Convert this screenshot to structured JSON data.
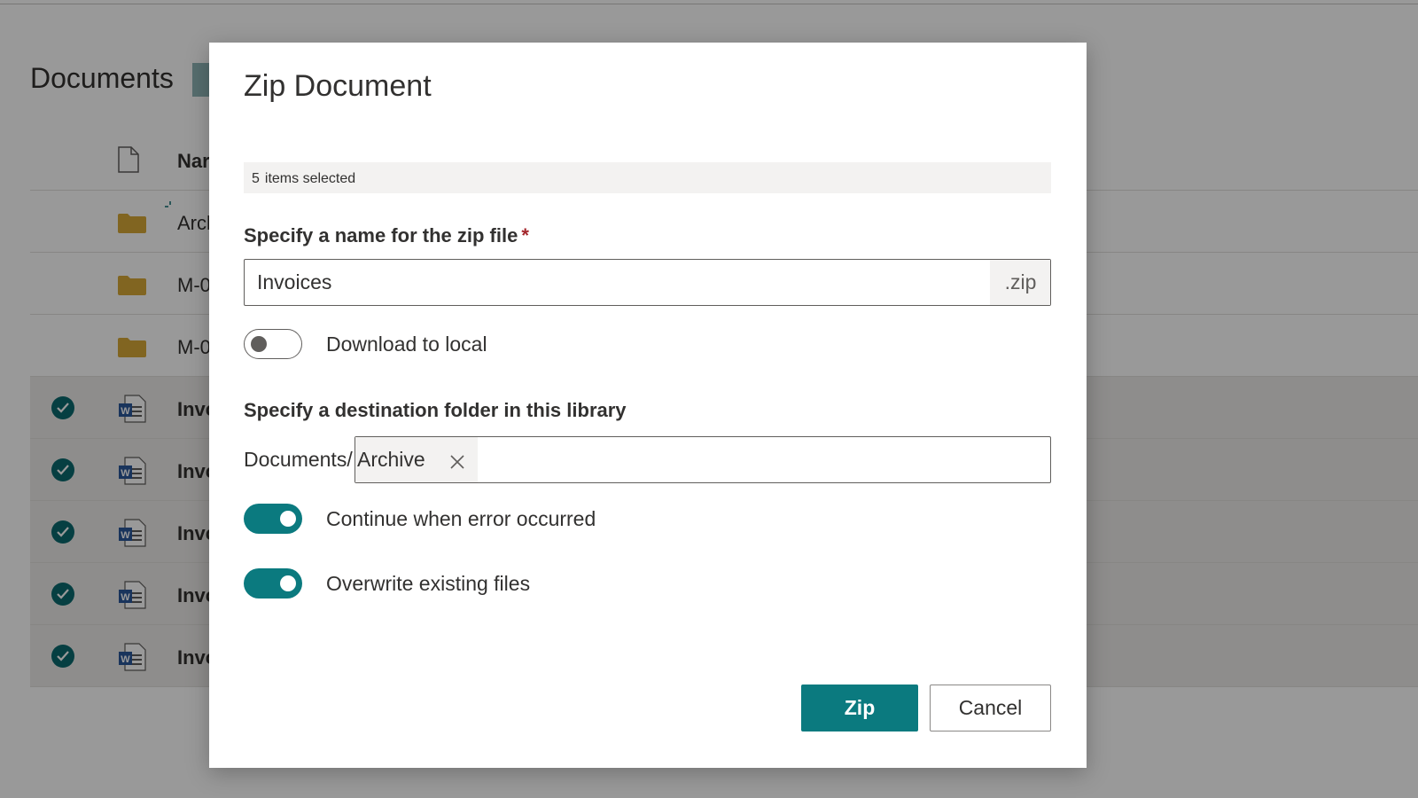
{
  "background": {
    "library_title": "Documents",
    "header": {
      "name_col": "Nar"
    },
    "rows": [
      {
        "name": "Arcl",
        "type": "folder",
        "selected": false
      },
      {
        "name": "M-0",
        "type": "folder",
        "selected": false
      },
      {
        "name": "M-0",
        "type": "folder",
        "selected": false
      },
      {
        "name": "Invc",
        "type": "word",
        "selected": true
      },
      {
        "name": "Invc",
        "type": "word",
        "selected": true
      },
      {
        "name": "Invc",
        "type": "word",
        "selected": true
      },
      {
        "name": "Invc",
        "type": "word",
        "selected": true
      },
      {
        "name": "Invc",
        "type": "word",
        "selected": true
      }
    ]
  },
  "dialog": {
    "title": "Zip Document",
    "selection": {
      "count": "5",
      "text": "items selected"
    },
    "zip_name": {
      "label": "Specify a name for the zip file",
      "required_mark": "*",
      "value": "Invoices",
      "suffix": ".zip"
    },
    "download_local": {
      "label": "Download to local",
      "on": false
    },
    "destination": {
      "label": "Specify a destination folder in this library",
      "prefix": "Documents/",
      "chip": "Archive"
    },
    "continue_on_error": {
      "label": "Continue when error occurred",
      "on": true
    },
    "overwrite": {
      "label": "Overwrite existing files",
      "on": true
    },
    "buttons": {
      "zip": "Zip",
      "cancel": "Cancel"
    }
  },
  "colors": {
    "accent": "#0b7a7f",
    "check": "#0b6a6e",
    "folder": "#d7a838",
    "word": "#2b579a"
  }
}
